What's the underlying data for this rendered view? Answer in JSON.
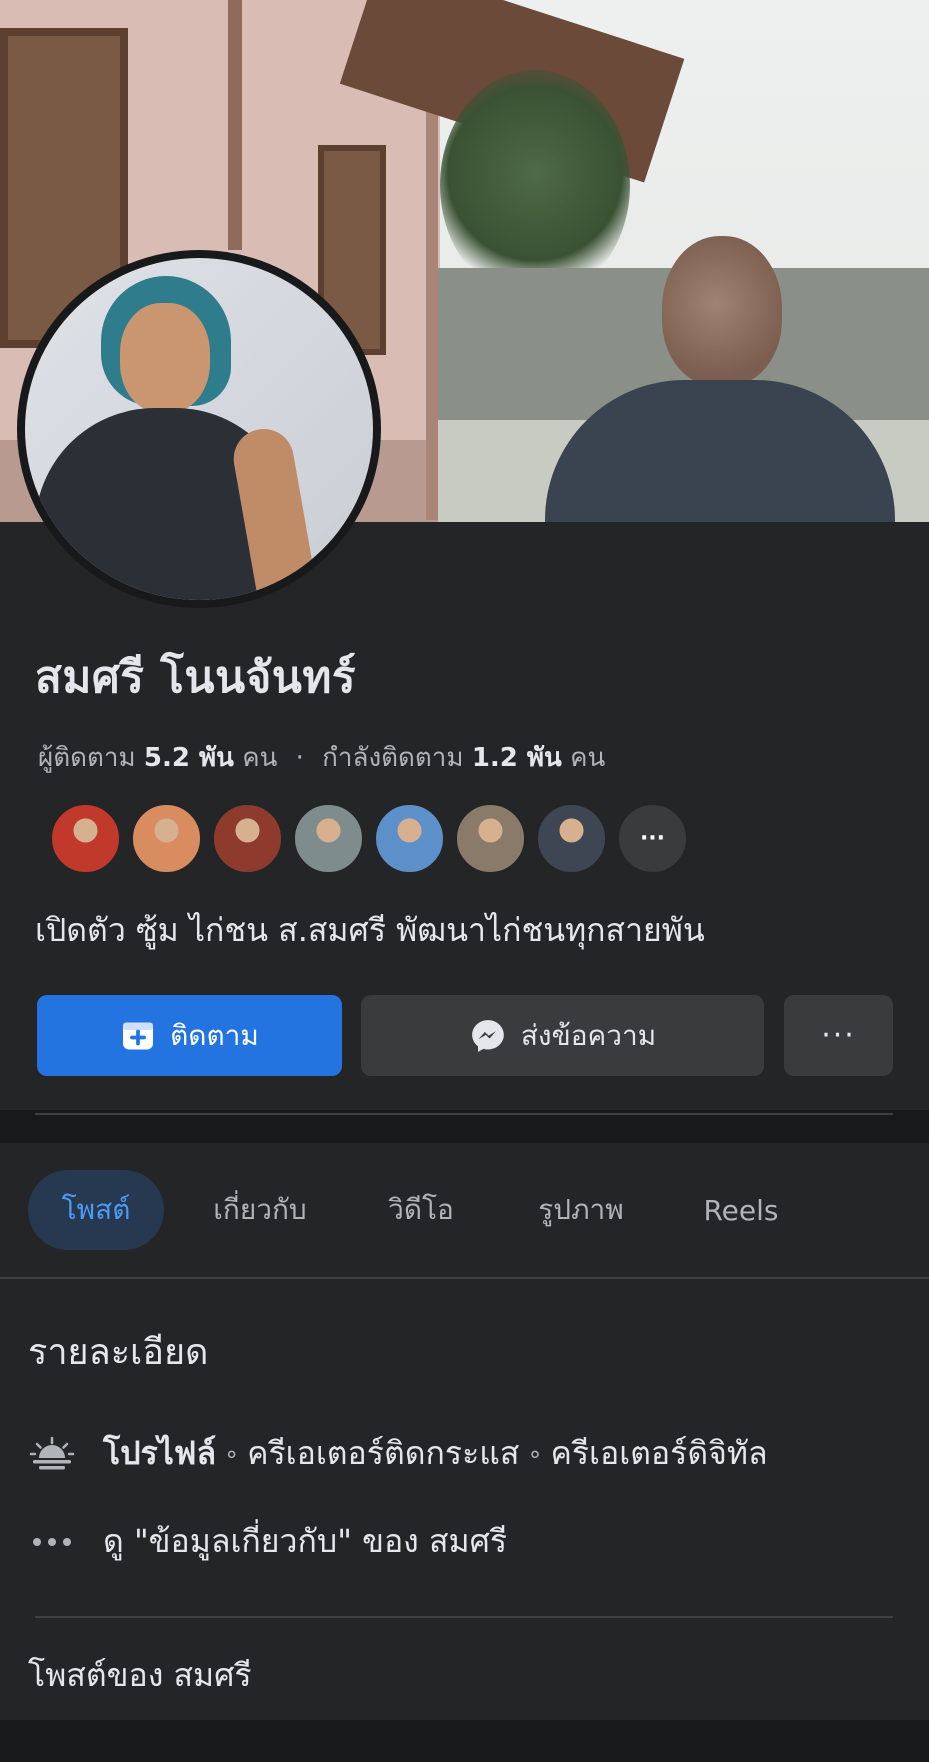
{
  "profile": {
    "name": "สมศรี โนนจันทร์",
    "followers_label": "ผู้ติดตาม",
    "followers_count": "5.2 พัน",
    "followers_unit": "คน",
    "following_label": "กำลังติดตาม",
    "following_count": "1.2 พัน",
    "following_unit": "คน",
    "bio": "เปิดตัว ซู้ม ไก่ชน  ส.สมศรี พัฒนาไก่ชนทุกสายพัน"
  },
  "actions": {
    "follow_label": "ติดตาม",
    "message_label": "ส่งข้อความ",
    "more_label": "···"
  },
  "friends": [
    {
      "color": "#c0392b"
    },
    {
      "color": "#d98c5f"
    },
    {
      "color": "#8e3b2e"
    },
    {
      "color": "#7f8c8d"
    },
    {
      "color": "#5d8fc9"
    },
    {
      "color": "#8a7a6a"
    },
    {
      "color": "#3d4652"
    }
  ],
  "tabs": [
    {
      "label": "โพสต์",
      "active": true
    },
    {
      "label": "เกี่ยวกับ",
      "active": false
    },
    {
      "label": "วิดีโอ",
      "active": false
    },
    {
      "label": "รูปภาพ",
      "active": false
    },
    {
      "label": "Reels",
      "active": false
    }
  ],
  "details": {
    "title": "รายละเอียด",
    "profile_label": "โปรไฟล์",
    "category_1": "ครีเอเตอร์ติดกระแส",
    "category_2": "ครีเอเตอร์ดิจิทัล",
    "about_text": "ดู \"ข้อมูลเกี่ยวกับ\" ของ สมศรี",
    "separator": "∘"
  },
  "posts_title": "โพสต์ของ สมศรี",
  "icons": {
    "follow": "add-friend-icon",
    "message": "messenger-icon",
    "profile": "sunrise-icon",
    "about": "ellipsis-icon"
  },
  "colors": {
    "accent": "#2374e1",
    "background": "#242526",
    "tab_active_bg": "#263951",
    "tab_active_text": "#4c9bf5"
  }
}
